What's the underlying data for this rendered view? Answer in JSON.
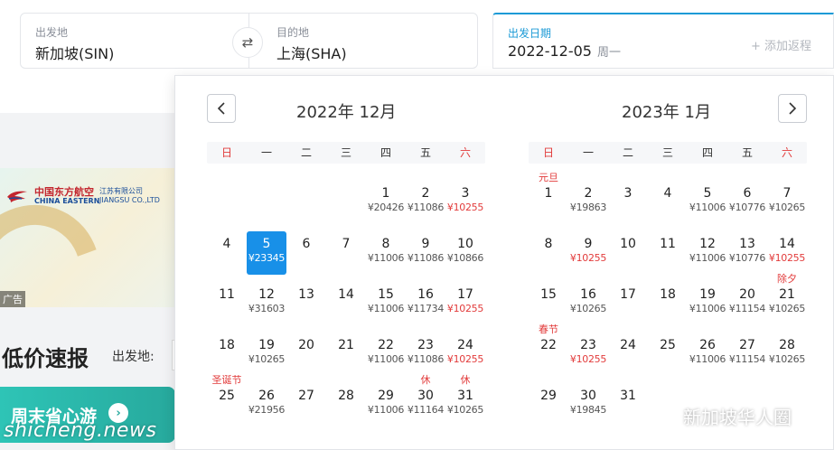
{
  "search": {
    "from_label": "出发地",
    "from_value": "新加坡(SIN)",
    "to_label": "目的地",
    "to_value": "上海(SHA)",
    "date_label": "出发日期",
    "date_value": "2022-12-05",
    "date_weekday": "周一",
    "add_return": "+ 添加返程"
  },
  "ad": {
    "airline_cn": "中国东方航空",
    "airline_en": "CHINA EASTERN",
    "branch": "江苏有限公司 JIANGSU CO.,LTD",
    "tag": "广告"
  },
  "promo": {
    "title": "低价速报",
    "from_label": "出发地:",
    "weekend": "周末省心游",
    "watermark": "shicheng.news"
  },
  "calendar": {
    "month1_title": "2022年 12月",
    "month2_title": "2023年 1月",
    "weekdays": [
      "日",
      "一",
      "二",
      "三",
      "四",
      "五",
      "六"
    ],
    "month1_start": 4,
    "month2_start": 0,
    "month1_days": [
      {
        "d": "1",
        "p": "¥20426"
      },
      {
        "d": "2",
        "p": "¥11086"
      },
      {
        "d": "3",
        "p": "¥10255",
        "low": true
      },
      {
        "d": "4"
      },
      {
        "d": "5",
        "p": "¥23345",
        "sel": true
      },
      {
        "d": "6"
      },
      {
        "d": "7"
      },
      {
        "d": "8",
        "p": "¥11006"
      },
      {
        "d": "9",
        "p": "¥11086"
      },
      {
        "d": "10",
        "p": "¥10866"
      },
      {
        "d": "11"
      },
      {
        "d": "12",
        "p": "¥31603"
      },
      {
        "d": "13"
      },
      {
        "d": "14"
      },
      {
        "d": "15",
        "p": "¥11006"
      },
      {
        "d": "16",
        "p": "¥11734"
      },
      {
        "d": "17",
        "p": "¥10255",
        "low": true
      },
      {
        "d": "18"
      },
      {
        "d": "19",
        "p": "¥10265"
      },
      {
        "d": "20"
      },
      {
        "d": "21"
      },
      {
        "d": "22",
        "p": "¥11006"
      },
      {
        "d": "23",
        "p": "¥11086"
      },
      {
        "d": "24",
        "p": "¥10255",
        "low": true
      },
      {
        "d": "25",
        "t": "圣诞节"
      },
      {
        "d": "26",
        "p": "¥21956"
      },
      {
        "d": "27"
      },
      {
        "d": "28"
      },
      {
        "d": "29",
        "p": "¥11006"
      },
      {
        "d": "30",
        "p": "¥11164",
        "t": "休"
      },
      {
        "d": "31",
        "p": "¥10265",
        "t": "休"
      }
    ],
    "month2_days": [
      {
        "d": "1",
        "t": "元旦"
      },
      {
        "d": "2",
        "p": "¥19863"
      },
      {
        "d": "3"
      },
      {
        "d": "4"
      },
      {
        "d": "5",
        "p": "¥11006"
      },
      {
        "d": "6",
        "p": "¥10776"
      },
      {
        "d": "7",
        "p": "¥10265"
      },
      {
        "d": "8"
      },
      {
        "d": "9",
        "p": "¥10255",
        "low": true
      },
      {
        "d": "10"
      },
      {
        "d": "11"
      },
      {
        "d": "12",
        "p": "¥11006"
      },
      {
        "d": "13",
        "p": "¥10776"
      },
      {
        "d": "14",
        "p": "¥10255",
        "low": true
      },
      {
        "d": "15"
      },
      {
        "d": "16",
        "p": "¥10265"
      },
      {
        "d": "17"
      },
      {
        "d": "18"
      },
      {
        "d": "19",
        "p": "¥11006"
      },
      {
        "d": "20",
        "p": "¥11154"
      },
      {
        "d": "21",
        "p": "¥10265",
        "t": "除夕"
      },
      {
        "d": "22",
        "t": "春节"
      },
      {
        "d": "23",
        "p": "¥10255",
        "low": true
      },
      {
        "d": "24"
      },
      {
        "d": "25"
      },
      {
        "d": "26",
        "p": "¥11006"
      },
      {
        "d": "27",
        "p": "¥11154"
      },
      {
        "d": "28",
        "p": "¥10265"
      },
      {
        "d": "29"
      },
      {
        "d": "30",
        "p": "¥19845"
      },
      {
        "d": "31"
      }
    ]
  },
  "watermark_right": "新加坡华人圈",
  "colors": {
    "accent": "#1890e8",
    "price_low": "#e23b3b",
    "weekend_green": "#2ec4b6"
  }
}
